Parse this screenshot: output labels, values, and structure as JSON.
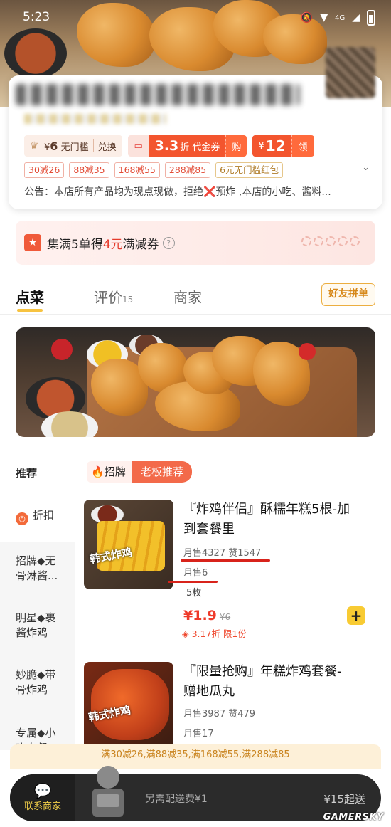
{
  "status_bar": {
    "time": "5:23",
    "network": "4G"
  },
  "coupons": {
    "no_threshold": {
      "currency": "¥",
      "amount": "6",
      "label": "无门槛",
      "action": "兑换"
    },
    "voucher": {
      "amount": "3.3",
      "label": "折 代金券",
      "action": "购"
    },
    "cash": {
      "currency": "¥",
      "amount": "12",
      "action": "领"
    }
  },
  "discount_tags": [
    "30减26",
    "88减35",
    "168减55",
    "288减85",
    "6元无门槛红包"
  ],
  "notice": {
    "prefix": "公告：本店所有产品均为现点现做，拒绝",
    "x": "❌",
    "suffix": "预炸 ,本店的小吃、酱料..."
  },
  "collect": {
    "pre": "集满5单得",
    "amount": "4元",
    "post": "满减券",
    "question": "?"
  },
  "tabs": [
    {
      "label": "点菜"
    },
    {
      "label": "评价",
      "count": "15"
    },
    {
      "label": "商家"
    }
  ],
  "friend_order": "好友拼单",
  "section": {
    "title": "推荐",
    "tag1": "招牌",
    "tag2": "老板推荐"
  },
  "sidebar": [
    {
      "label": "折扣"
    },
    {
      "label": "招牌◆无骨淋酱..."
    },
    {
      "label": "明星◆裹酱炸鸡"
    },
    {
      "label": "妙脆◆带骨炸鸡"
    },
    {
      "label": "专属◆小吃套餐"
    }
  ],
  "dishes": [
    {
      "name": "『炸鸡伴侣』酥糯年糕5根-加到套餐里",
      "monthly": "月售4327",
      "likes": "赞1547",
      "monthly2": "月售6",
      "spec": "5枚",
      "price_symbol": "¥",
      "price": "1.9",
      "original": "¥6",
      "discount": "3.17折 限1份",
      "img_text": "韩式炸鸡"
    },
    {
      "name": "『限量抢购』年糕炸鸡套餐-赠地瓜丸",
      "monthly": "月售3987",
      "likes": "赞479",
      "monthly2": "月售17",
      "img_text": "韩式炸鸡"
    }
  ],
  "bottom": {
    "promo": "满30减26,满88减35,满168减55,满288减85",
    "contact": "联系商家",
    "delivery_fee": "另需配送费¥1",
    "min_order": "¥15起送"
  },
  "watermark": "GAMERSKY"
}
